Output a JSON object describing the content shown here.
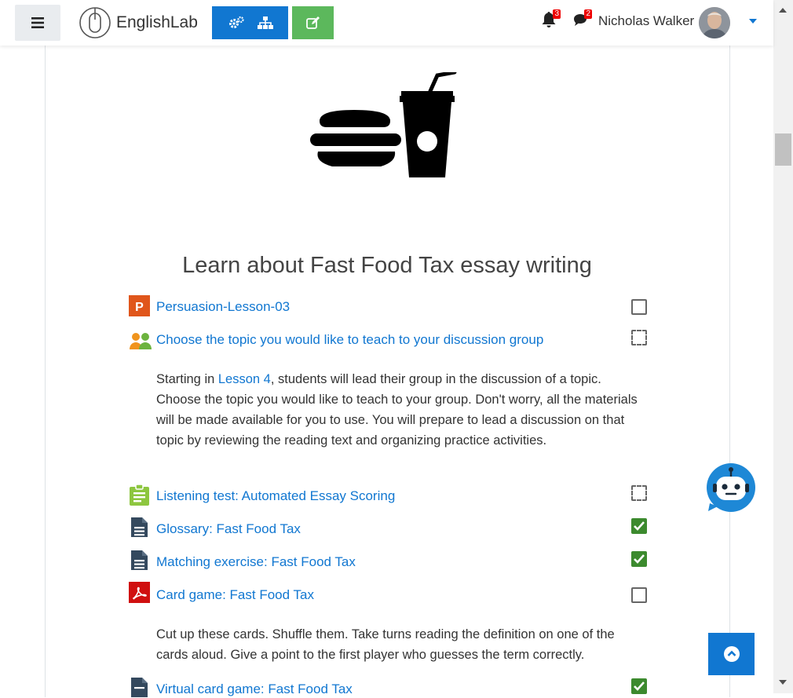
{
  "header": {
    "brand": "EnglishLab",
    "notifications_count": "3",
    "messages_count": "2",
    "user_name": "Nicholas Walker"
  },
  "section": {
    "title": "Learn about Fast Food Tax essay writing"
  },
  "activities": [
    {
      "label": "Persuasion-Lesson-03",
      "icon": "presentation-icon",
      "completion": "manual-incomplete"
    },
    {
      "label": "Choose the topic you would like to teach to your discussion group",
      "icon": "group-choice-icon",
      "completion": "auto-incomplete"
    },
    {
      "label": "Listening test: Automated Essay Scoring",
      "icon": "assignment-icon",
      "completion": "auto-incomplete"
    },
    {
      "label": "Glossary: Fast Food Tax",
      "icon": "document-icon",
      "completion": "complete"
    },
    {
      "label": "Matching exercise: Fast Food Tax",
      "icon": "document-icon",
      "completion": "complete"
    },
    {
      "label": "Card game: Fast Food Tax",
      "icon": "pdf-icon",
      "completion": "manual-incomplete"
    },
    {
      "label": "Virtual card game: Fast Food Tax",
      "icon": "document-icon",
      "completion": "complete"
    }
  ],
  "descriptions": {
    "choose_topic": {
      "before_link": "Starting in ",
      "link": "Lesson 4",
      "after_link": ", students will lead their group in the discussion of a topic. Choose the topic you would like to teach to your group. Don't worry, all the materials will be made available for you to use. You will prepare to lead a discussion on  that topic by reviewing the reading text and organizing practice activities."
    },
    "card_game": "Cut up these cards. Shuffle them. Take turns reading the definition on one of the cards aloud. Give a point to the first player who guesses the term correctly."
  },
  "colors": {
    "link": "#1177d1",
    "primary_button": "#1177d1",
    "success_button": "#5cb85c",
    "check_complete": "#3c8a2e",
    "badge": "#e00000",
    "presentation_icon": "#e0561b",
    "assignment_icon": "#8dc63f",
    "pdf_icon": "#d01010",
    "document_icon": "#34495e"
  }
}
